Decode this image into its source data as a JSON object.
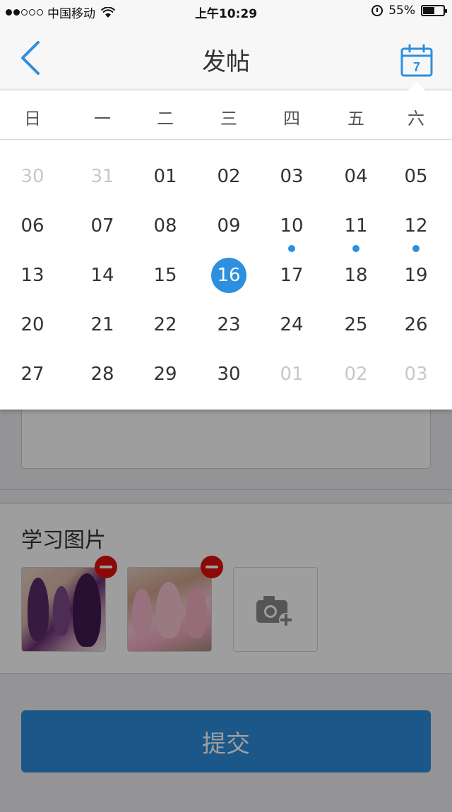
{
  "status_bar": {
    "carrier": "中国移动",
    "time": "上午10:29",
    "battery": "55%"
  },
  "nav": {
    "title": "发帖",
    "calendar_icon_day": "7"
  },
  "calendar": {
    "weekdays": [
      "日",
      "一",
      "二",
      "三",
      "四",
      "五",
      "六"
    ],
    "weeks": [
      [
        "30",
        "31",
        "01",
        "02",
        "03",
        "04",
        "05"
      ],
      [
        "06",
        "07",
        "08",
        "09",
        "10",
        "11",
        "12"
      ],
      [
        "13",
        "14",
        "15",
        "16",
        "17",
        "18",
        "19"
      ],
      [
        "20",
        "21",
        "22",
        "23",
        "24",
        "25",
        "26"
      ],
      [
        "27",
        "28",
        "29",
        "30",
        "01",
        "02",
        "03"
      ]
    ],
    "muted_days": [
      [
        0,
        0
      ],
      [
        0,
        1
      ],
      [
        4,
        4
      ],
      [
        4,
        5
      ],
      [
        4,
        6
      ]
    ],
    "event_days": [
      [
        1,
        4
      ],
      [
        1,
        5
      ],
      [
        1,
        6
      ]
    ],
    "selected_day": [
      2,
      3
    ],
    "accent_color": "#2d8fde"
  },
  "photos": {
    "title": "学习图片",
    "remove_icon": "minus-circle-icon",
    "add_icon": "camera-plus-icon"
  },
  "submit_label": "提交"
}
